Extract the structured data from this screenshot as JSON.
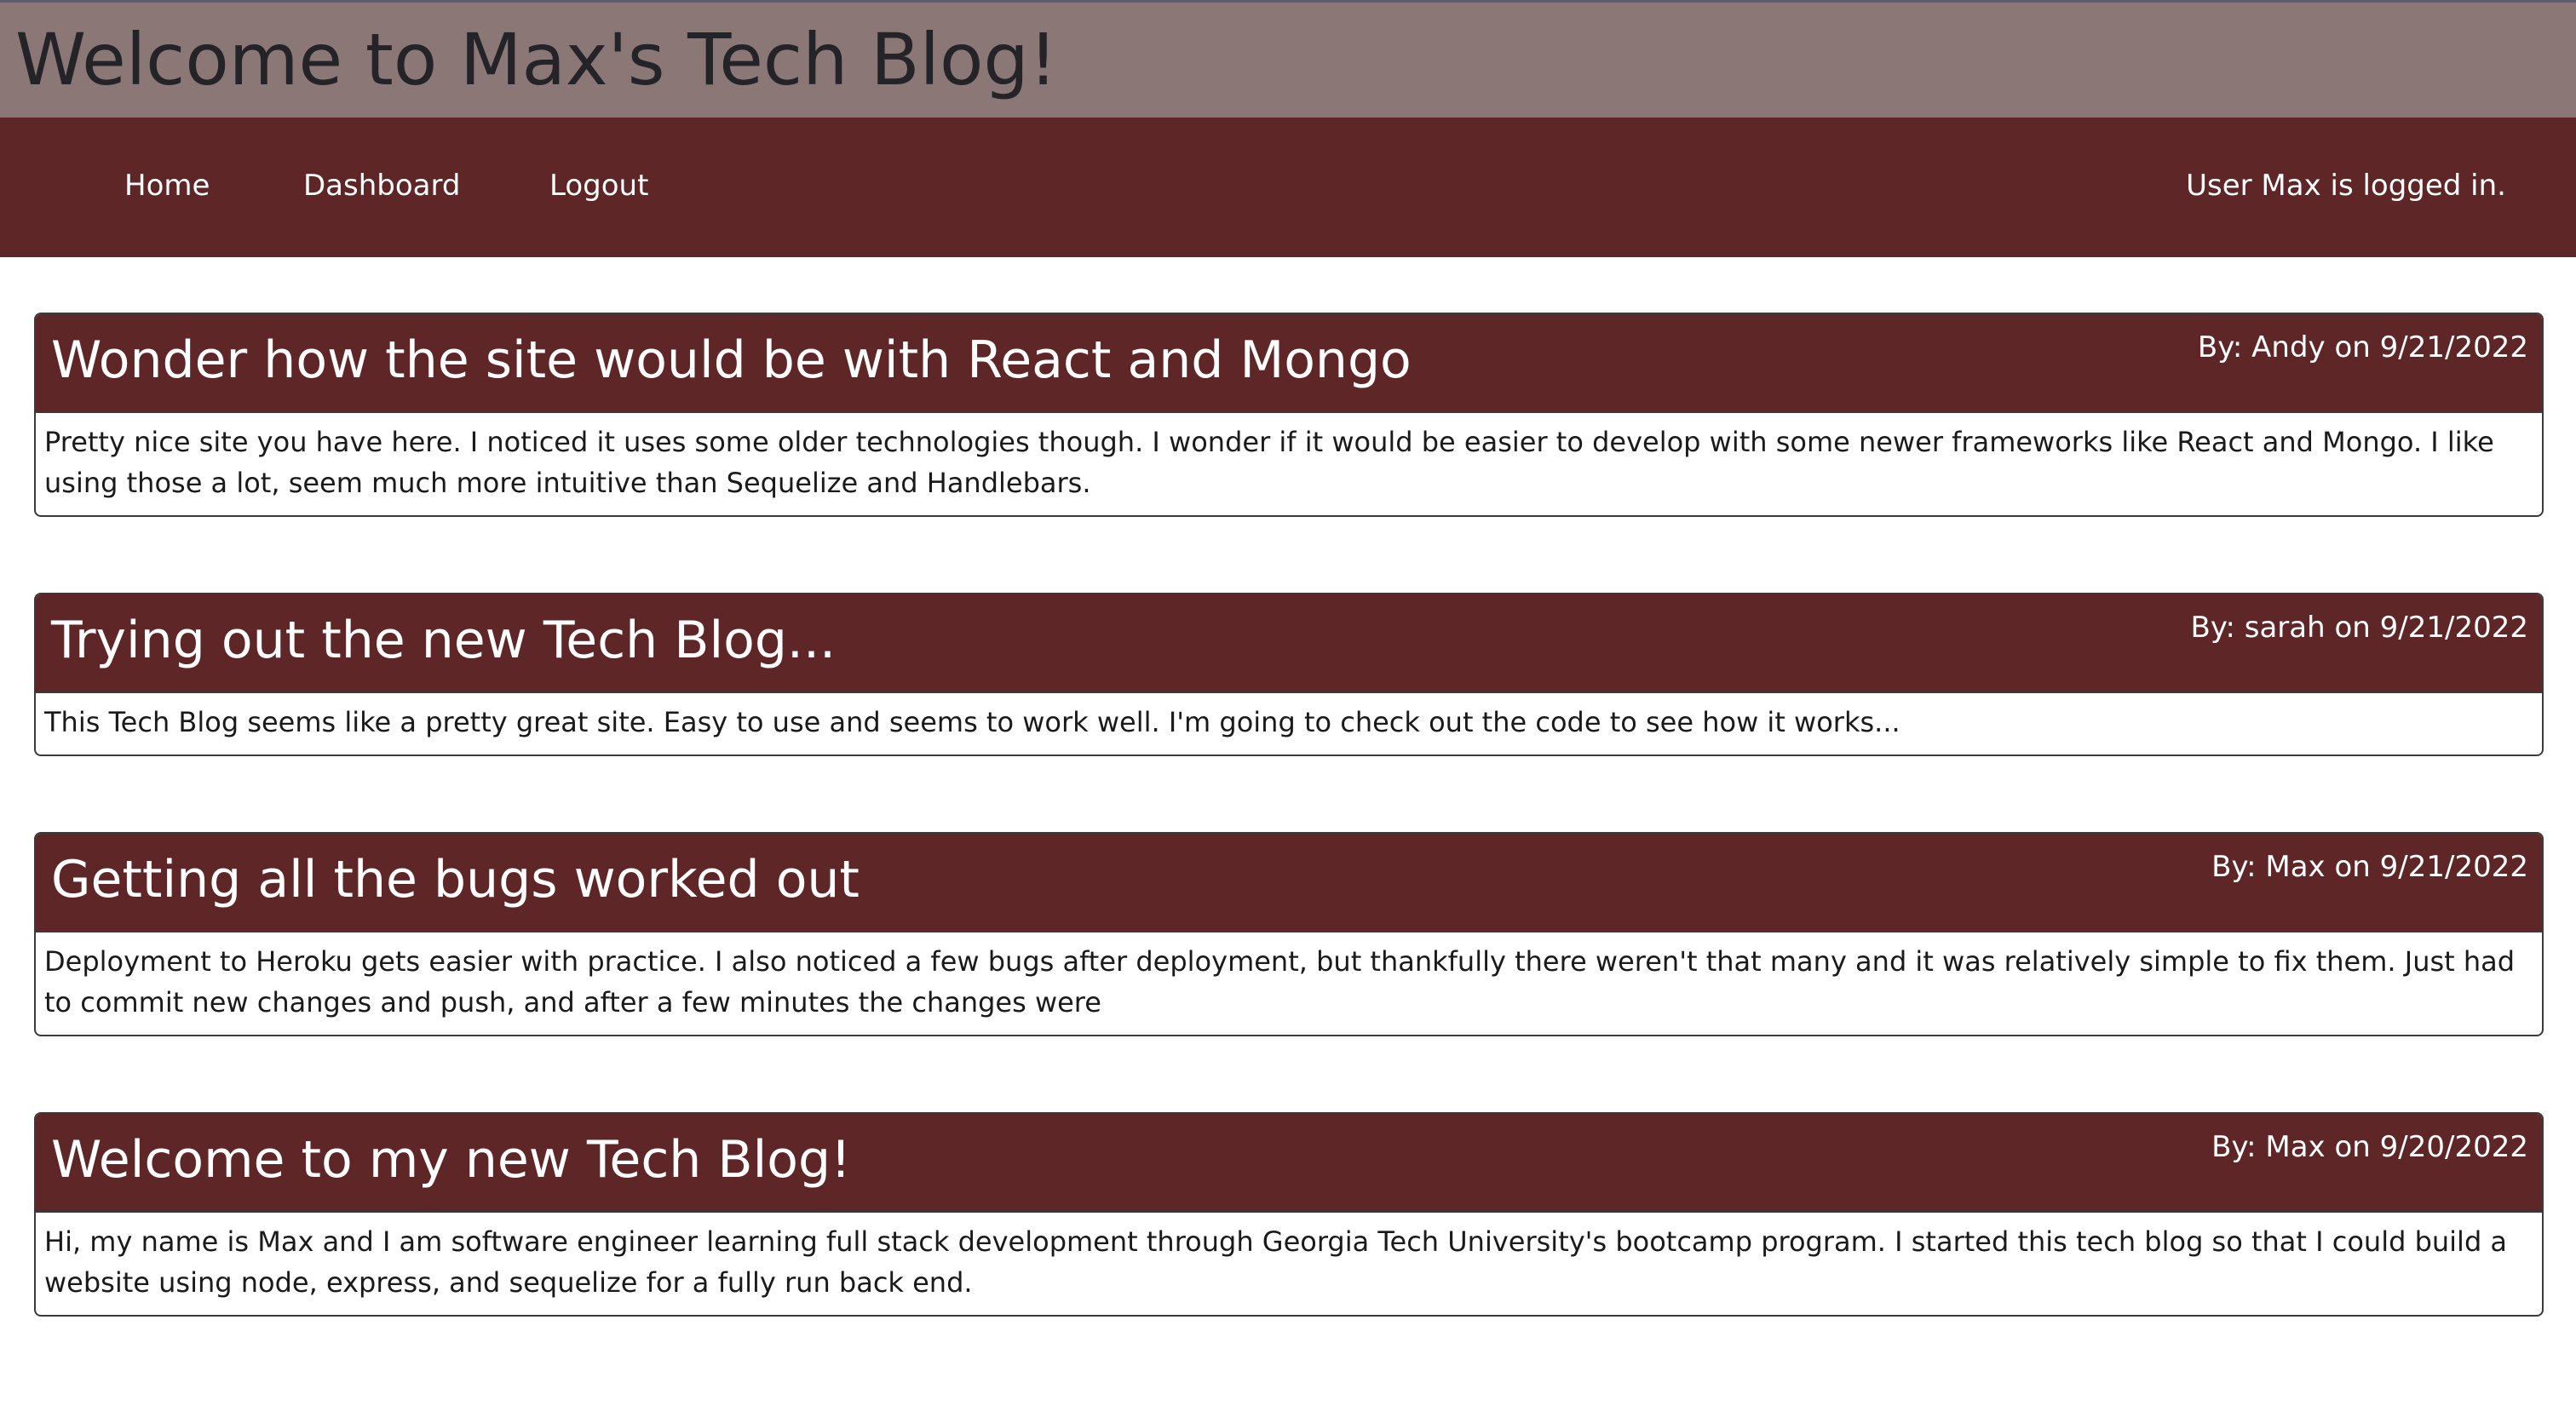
{
  "header": {
    "title": "Welcome to Max's Tech Blog!"
  },
  "nav": {
    "home": "Home",
    "dashboard": "Dashboard",
    "logout": "Logout",
    "status": "User Max is logged in."
  },
  "posts": [
    {
      "title": "Wonder how the site would be with React and Mongo",
      "by_label": "By:",
      "author": "Andy",
      "on_label": "on",
      "date": "9/21/2022",
      "body": "Pretty nice site you have here. I noticed it uses some older technologies though. I wonder if it would be easier to develop with some newer frameworks like React and Mongo. I like using those a lot, seem much more intuitive than Sequelize and Handlebars."
    },
    {
      "title": "Trying out the new Tech Blog...",
      "by_label": "By:",
      "author": "sarah",
      "on_label": "on",
      "date": "9/21/2022",
      "body": "This Tech Blog seems like a pretty great site. Easy to use and seems to work well. I'm going to check out the code to see how it works..."
    },
    {
      "title": "Getting all the bugs worked out",
      "by_label": "By:",
      "author": "Max",
      "on_label": "on",
      "date": "9/21/2022",
      "body": "Deployment to Heroku gets easier with practice. I also noticed a few bugs after deployment, but thankfully there weren't that many and it was relatively simple to fix them. Just had to commit new changes and push, and after a few minutes the changes were"
    },
    {
      "title": "Welcome to my new Tech Blog!",
      "by_label": "By:",
      "author": "Max",
      "on_label": "on",
      "date": "9/20/2022",
      "body": "Hi, my name is Max and I am software engineer learning full stack development through Georgia Tech University's bootcamp program. I started this tech blog so that I could build a website using node, express, and sequelize for a fully run back end."
    }
  ],
  "colors": {
    "header_bg": "#8c7777",
    "nav_bg": "#5e2627",
    "card_header_bg": "#5e2627",
    "title_text": "#242428"
  }
}
